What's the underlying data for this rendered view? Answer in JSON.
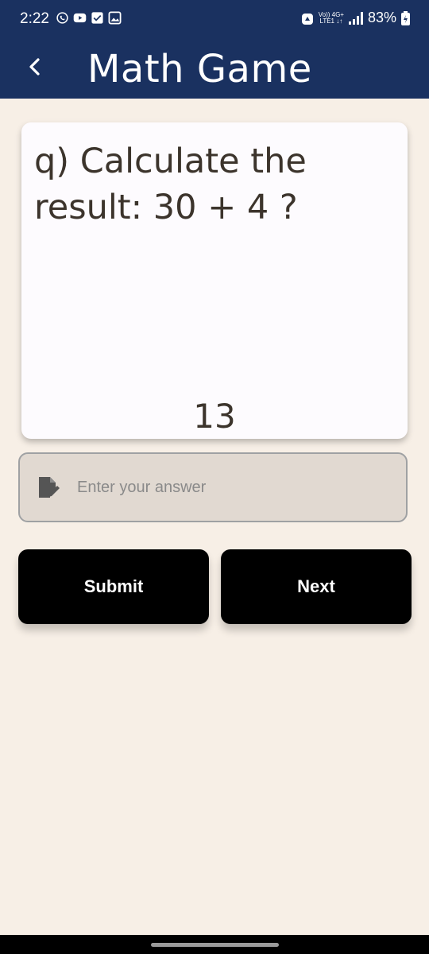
{
  "status_bar": {
    "time": "2:22",
    "network_label_top": "Vo)) 4G+",
    "network_label_bottom": "LTE1 ↓↑",
    "battery": "83%",
    "icons": [
      "whatsapp-icon",
      "youtube-icon",
      "checkbox-mail-icon",
      "gallery-icon",
      "alarm-icon",
      "signal-icon",
      "battery-charging-icon"
    ]
  },
  "app_bar": {
    "title": "Math Game",
    "back_icon": "chevron-left-icon"
  },
  "question": {
    "text": "q) Calculate the result: 30 + 4 ?",
    "current_answer": "13"
  },
  "answer_field": {
    "placeholder": "Enter your answer",
    "value": "",
    "icon": "edit-note-icon"
  },
  "buttons": {
    "submit_label": "Submit",
    "next_label": "Next"
  },
  "colors": {
    "app_bar": "#1a3160",
    "background": "#f7efe6",
    "card": "#fdfbfe",
    "text": "#3c342c",
    "button": "#000000",
    "field_bg": "#e1d9d1"
  }
}
